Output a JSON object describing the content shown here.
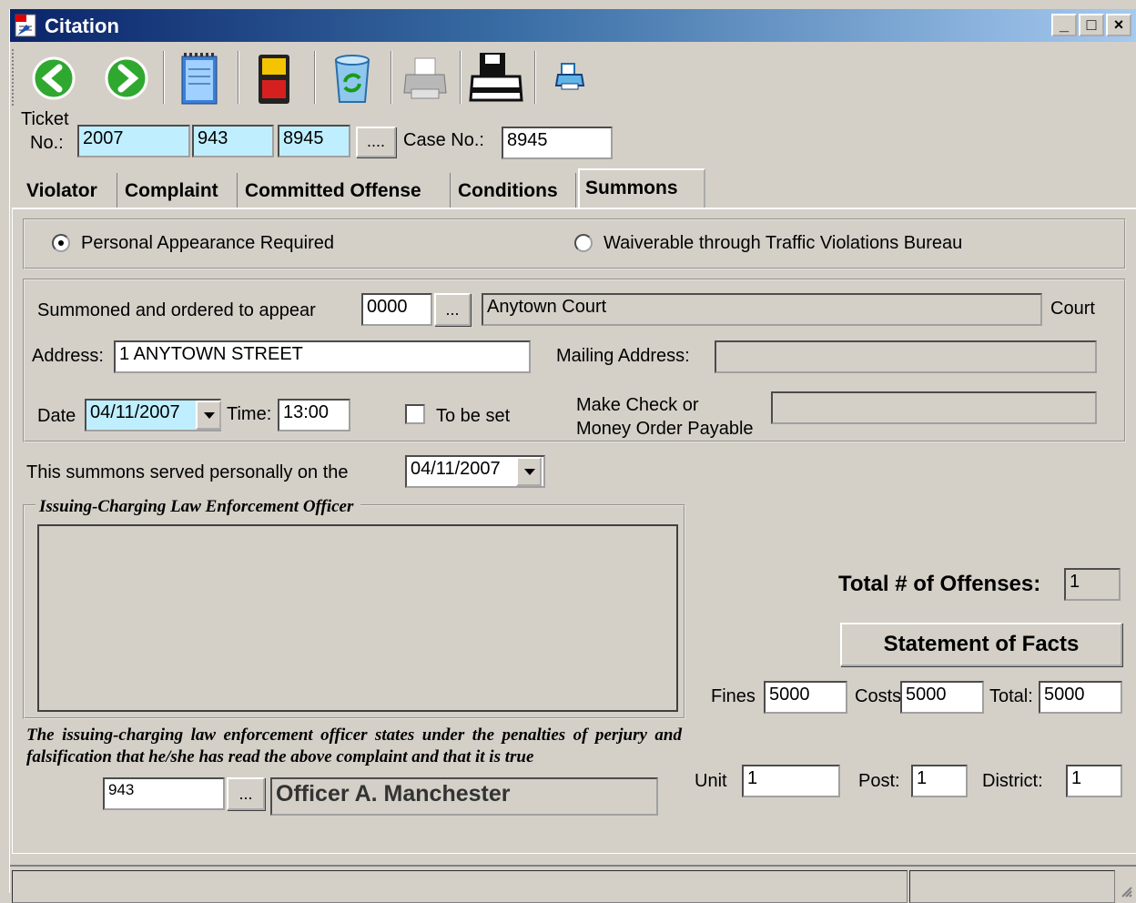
{
  "window": {
    "title": "Citation",
    "minimize": "_",
    "maximize": "□",
    "close": "×"
  },
  "ticket": {
    "label_1": "Ticket",
    "label_2": "No.:",
    "part1": "2007",
    "part2": "943",
    "part3": "8945",
    "lookup_label": "....",
    "case_label": "Case No.:",
    "case_no": "8945"
  },
  "tabs": [
    "Violator",
    "Complaint",
    "Committed Offense",
    "Conditions",
    "Summons"
  ],
  "appearance": {
    "personal_label": "Personal Appearance Required",
    "waiver_label": "Waiverable through Traffic Violations Bureau",
    "selected": "personal"
  },
  "court": {
    "summoned_label": "Summoned and ordered to appear",
    "court_code": "0000",
    "lookup_label": "...",
    "court_name": "Anytown Court",
    "court_label": "Court",
    "address_label": "Address:",
    "address": "1 ANYTOWN STREET",
    "mailing_label": "Mailing Address:",
    "mailing": "",
    "date_label": "Date",
    "date": "04/11/2007",
    "time_label": "Time:",
    "time": "13:00",
    "to_be_set_label": "To be set",
    "payable_label_1": "Make Check or",
    "payable_label_2": "Money Order Payable",
    "payable": ""
  },
  "served": {
    "label": "This summons served personally on the",
    "date": "04/11/2007"
  },
  "officer": {
    "group_label": "Issuing-Charging Law Enforcement Officer",
    "statement": "The issuing-charging law enforcement officer states under the penalties of perjury and falsification that he/she has read the above complaint and that it is true",
    "badge": "943",
    "lookup_label": "...",
    "name": "Officer A. Manchester"
  },
  "totals": {
    "offenses_label": "Total # of Offenses:",
    "offenses": "1",
    "facts_button": "Statement of Facts",
    "fines_label": "Fines",
    "fines": "5000",
    "costs_label": "Costs",
    "costs": "5000",
    "total_label": "Total:",
    "total": "5000",
    "unit_label": "Unit",
    "unit": "1",
    "post_label": "Post:",
    "post": "1",
    "district_label": "District:",
    "district": "1"
  },
  "toolbar_icons": [
    "back-arrow-icon",
    "forward-arrow-icon",
    "notepad-icon",
    "save-disk-icon",
    "recycle-bin-icon",
    "printer-icon",
    "save-print-icon",
    "print-preview-icon"
  ]
}
